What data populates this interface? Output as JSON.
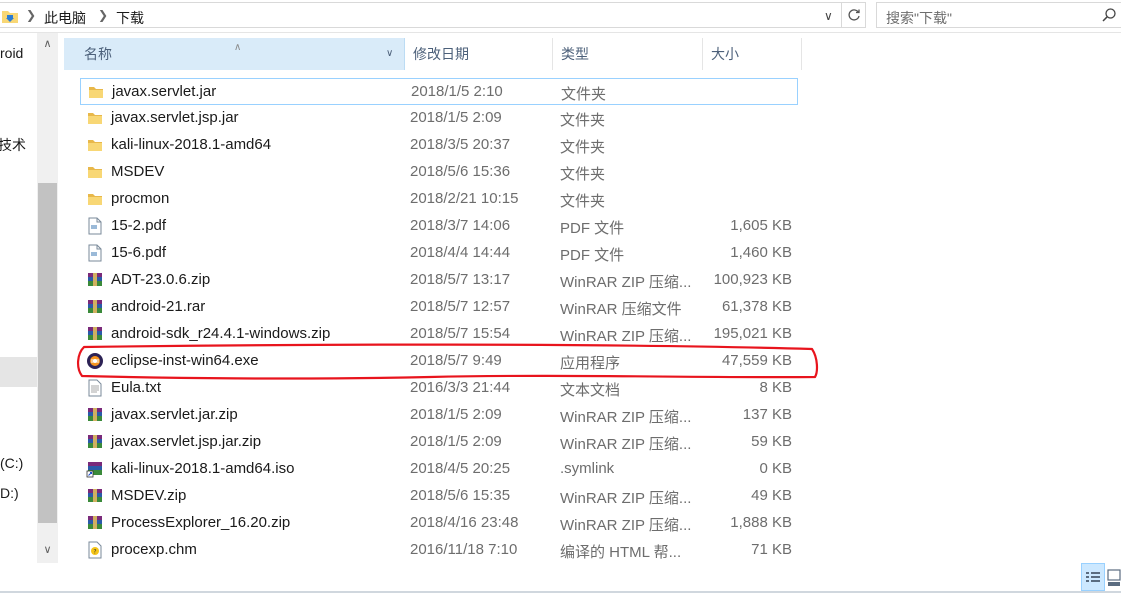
{
  "address": {
    "crumbs": [
      "此电脑",
      "下载"
    ],
    "search_placeholder": "搜索\"下载\""
  },
  "nav": {
    "items": [
      {
        "label": "roid"
      },
      {
        "label": "技术"
      },
      {
        "label": "(C:)"
      },
      {
        "label": "D:)"
      }
    ]
  },
  "columns": {
    "name": "名称",
    "date": "修改日期",
    "type": "类型",
    "size": "大小"
  },
  "files": [
    {
      "name": "javax.servlet.jar",
      "date": "2018/1/5 2:10",
      "type": "文件夹",
      "size": "",
      "icon": "folder-icon"
    },
    {
      "name": "javax.servlet.jsp.jar",
      "date": "2018/1/5 2:09",
      "type": "文件夹",
      "size": "",
      "icon": "folder-icon"
    },
    {
      "name": "kali-linux-2018.1-amd64",
      "date": "2018/3/5 20:37",
      "type": "文件夹",
      "size": "",
      "icon": "folder-icon"
    },
    {
      "name": "MSDEV",
      "date": "2018/5/6 15:36",
      "type": "文件夹",
      "size": "",
      "icon": "folder-icon"
    },
    {
      "name": "procmon",
      "date": "2018/2/21 10:15",
      "type": "文件夹",
      "size": "",
      "icon": "folder-icon"
    },
    {
      "name": "15-2.pdf",
      "date": "2018/3/7 14:06",
      "type": "PDF 文件",
      "size": "1,605 KB",
      "icon": "pdf-file-icon"
    },
    {
      "name": "15-6.pdf",
      "date": "2018/4/4 14:44",
      "type": "PDF 文件",
      "size": "1,460 KB",
      "icon": "pdf-file-icon"
    },
    {
      "name": "ADT-23.0.6.zip",
      "date": "2018/5/7 13:17",
      "type": "WinRAR ZIP 压缩...",
      "size": "100,923 KB",
      "icon": "winrar-archive-icon"
    },
    {
      "name": "android-21.rar",
      "date": "2018/5/7 12:57",
      "type": "WinRAR 压缩文件",
      "size": "61,378 KB",
      "icon": "winrar-archive-icon"
    },
    {
      "name": "android-sdk_r24.4.1-windows.zip",
      "date": "2018/5/7 15:54",
      "type": "WinRAR ZIP 压缩...",
      "size": "195,021 KB",
      "icon": "winrar-archive-icon"
    },
    {
      "name": "eclipse-inst-win64.exe",
      "date": "2018/5/7 9:49",
      "type": "应用程序",
      "size": "47,559 KB",
      "icon": "eclipse-app-icon"
    },
    {
      "name": "Eula.txt",
      "date": "2016/3/3 21:44",
      "type": "文本文档",
      "size": "8 KB",
      "icon": "text-file-icon"
    },
    {
      "name": "javax.servlet.jar.zip",
      "date": "2018/1/5 2:09",
      "type": "WinRAR ZIP 压缩...",
      "size": "137 KB",
      "icon": "winrar-archive-icon"
    },
    {
      "name": "javax.servlet.jsp.jar.zip",
      "date": "2018/1/5 2:09",
      "type": "WinRAR ZIP 压缩...",
      "size": "59 KB",
      "icon": "winrar-archive-icon"
    },
    {
      "name": "kali-linux-2018.1-amd64.iso",
      "date": "2018/4/5 20:25",
      "type": ".symlink",
      "size": "0 KB",
      "icon": "winrar-shortcut-icon"
    },
    {
      "name": "MSDEV.zip",
      "date": "2018/5/6 15:35",
      "type": "WinRAR ZIP 压缩...",
      "size": "49 KB",
      "icon": "winrar-archive-icon"
    },
    {
      "name": "ProcessExplorer_16.20.zip",
      "date": "2018/4/16 23:48",
      "type": "WinRAR ZIP 压缩...",
      "size": "1,888 KB",
      "icon": "winrar-archive-icon"
    },
    {
      "name": "procexp.chm",
      "date": "2016/11/18 7:10",
      "type": "编译的 HTML 帮...",
      "size": "71 KB",
      "icon": "chm-help-icon"
    }
  ],
  "colors": {
    "header_selected": "#d9ebf9",
    "focus_border": "#99d1ff",
    "annotation_red": "#e8141d",
    "folder_yellow": "#f8d775"
  }
}
